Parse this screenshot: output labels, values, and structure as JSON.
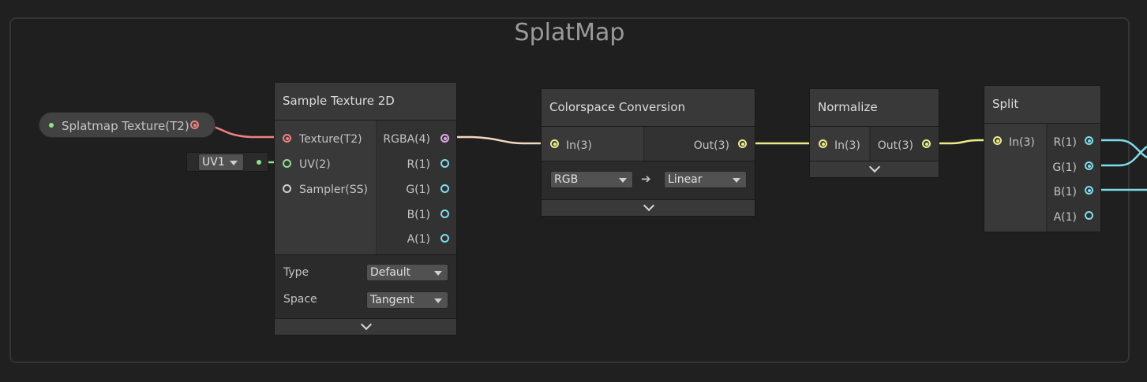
{
  "group": {
    "title": "SplatMap"
  },
  "property_node": {
    "label": "Splatmap Texture(T2)"
  },
  "uv_input": {
    "value": "UV1"
  },
  "sample_texture": {
    "title": "Sample Texture 2D",
    "inputs": [
      "Texture(T2)",
      "UV(2)",
      "Sampler(SS)"
    ],
    "outputs": [
      "RGBA(4)",
      "R(1)",
      "G(1)",
      "B(1)",
      "A(1)"
    ],
    "type_label": "Type",
    "type_value": "Default",
    "space_label": "Space",
    "space_value": "Tangent"
  },
  "colorspace": {
    "title": "Colorspace Conversion",
    "input": "In(3)",
    "output": "Out(3)",
    "from_value": "RGB",
    "arrow": "➔",
    "to_value": "Linear"
  },
  "normalize": {
    "title": "Normalize",
    "input": "In(3)",
    "output": "Out(3)"
  },
  "split": {
    "title": "Split",
    "input": "In(3)",
    "outputs": [
      "R(1)",
      "G(1)",
      "B(1)",
      "A(1)"
    ]
  },
  "colors": {
    "texture_port": "#f08080",
    "uv_port": "#8fe08f",
    "vector4_port": "#e0a8e8",
    "vector3_port": "#ecec8c",
    "float_port": "#7fdcec"
  }
}
